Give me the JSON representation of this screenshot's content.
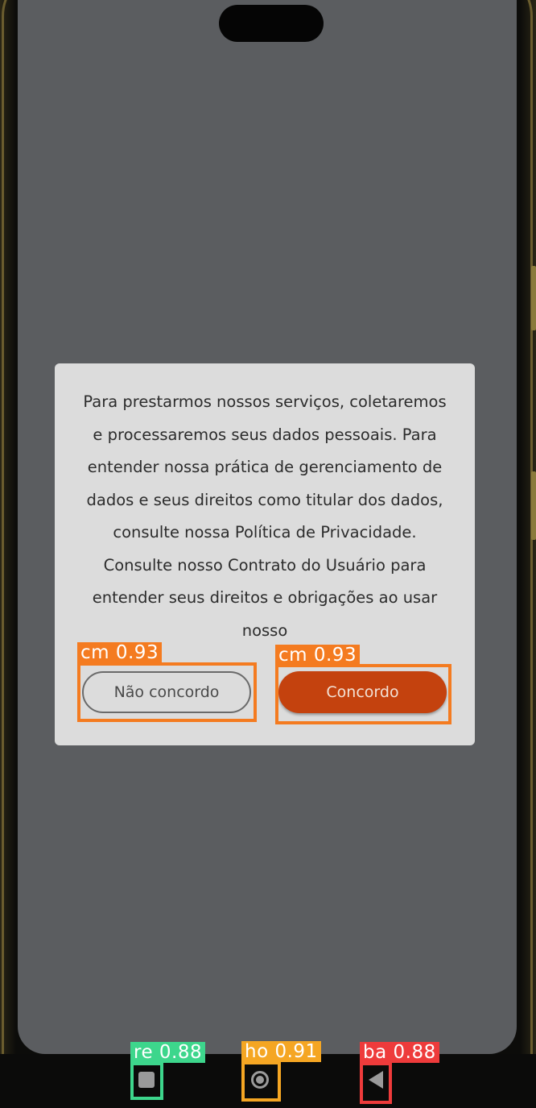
{
  "dialog": {
    "message": "Para prestarmos nossos serviços, coletaremos e processaremos seus dados pessoais. Para entender nossa prática de gerenciamento de dados e seus direitos como titular dos dados, consulte nossa Política de Privacidade. Consulte nosso Contrato do Usuário para entender seus direitos e obrigações ao usar nosso",
    "disagree_label": "Não concordo",
    "agree_label": "Concordo"
  },
  "navigation": {
    "recents_icon": "square-recents-icon",
    "home_icon": "circle-home-icon",
    "back_icon": "triangle-back-icon"
  },
  "detections": {
    "disagree_button": "cm 0.93",
    "agree_button": "cm 0.93",
    "recents": "re 0.88",
    "home": "ho 0.91",
    "back": "ba 0.88"
  },
  "colors": {
    "agree_button": "#c4420e",
    "dialog_background": "#dcdcdc",
    "overlay_background": "#5b5d60",
    "det_cm": "#f47b20",
    "det_re": "#3dd68c",
    "det_ho": "#f5a623",
    "det_ba": "#ee3b3b"
  }
}
